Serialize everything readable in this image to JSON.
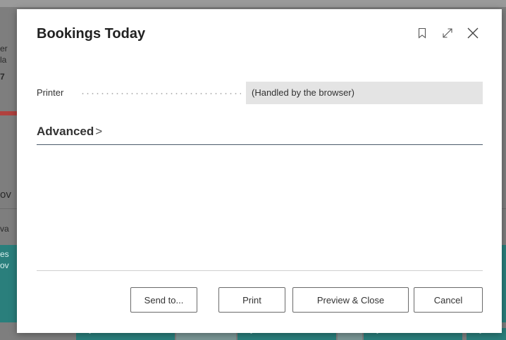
{
  "background": {
    "left_strip_text": [
      "er",
      "la",
      "7",
      "ov",
      "va",
      "es",
      "ov"
    ],
    "tile_chevrons": [
      ">",
      ">",
      ">",
      ">"
    ]
  },
  "dialog": {
    "title": "Bookings Today",
    "header_icons": [
      "bookmark-icon",
      "expand-icon",
      "close-icon"
    ],
    "field": {
      "label": "Printer",
      "value": "(Handled by the browser)"
    },
    "advanced": {
      "label": "Advanced",
      "chevron": ">"
    },
    "buttons": {
      "send_to": "Send to...",
      "print": "Print",
      "preview_close": "Preview & Close",
      "cancel": "Cancel"
    }
  }
}
